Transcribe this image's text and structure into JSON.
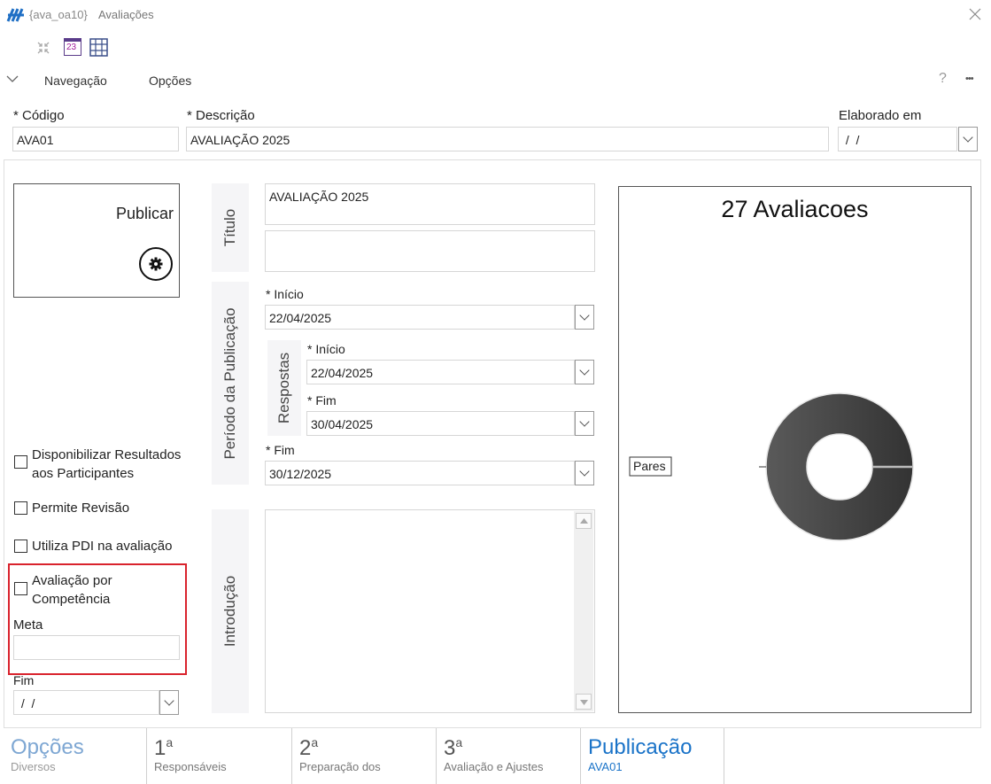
{
  "window": {
    "code": "{ava_oa10}",
    "title": "Avaliações"
  },
  "menu": {
    "nav_label": "Navegação",
    "options_label": "Opções",
    "help_symbol": "?",
    "more_symbol": "•••",
    "calendar_day": "23"
  },
  "header": {
    "codigo_label": "* Código",
    "codigo_value": "AVA01",
    "descricao_label": "* Descrição",
    "descricao_value": "AVALIAÇÃO 2025",
    "elaborado_label": "Elaborado em",
    "elaborado_value": " /  /"
  },
  "publish": {
    "label": "Publicar"
  },
  "titulo": {
    "label": "Título",
    "value": "AVALIAÇÃO 2025",
    "value2": ""
  },
  "periodo": {
    "label": "Período da Publicação",
    "inicio_label": "* Início",
    "inicio_value": "22/04/2025",
    "fim_label": "* Fim",
    "fim_value": "30/12/2025",
    "respostas": {
      "label": "Respostas",
      "inicio_label": "* Início",
      "inicio_value": "22/04/2025",
      "fim_label": "* Fim",
      "fim_value": "30/04/2025"
    }
  },
  "introducao": {
    "label": "Introdução"
  },
  "options": {
    "disponibilizar": "Disponibilizar Resultados aos Participantes",
    "permite_revisao": "Permite Revisão",
    "utiliza_pdi": "Utiliza PDI na avaliação",
    "competencia": "Avaliação por Competência",
    "meta_label": "Meta",
    "meta_value": "",
    "fim_label": "Fim",
    "fim_value": " /  /"
  },
  "chart_data": {
    "type": "pie",
    "title": "27 Avaliacoes",
    "labels": [
      "Pares"
    ],
    "values": [
      27
    ],
    "donut": true,
    "colors": [
      "#4a4a4a"
    ]
  },
  "tabs": [
    {
      "main": "Opções",
      "sub": "Diversos",
      "active": false,
      "faded": true
    },
    {
      "main": "1",
      "sup": "a",
      "sub": "Responsáveis"
    },
    {
      "main": "2",
      "sup": "a",
      "sub": "Preparação dos"
    },
    {
      "main": "3",
      "sup": "a",
      "sub": "Avaliação e Ajustes"
    },
    {
      "main": "Publicação",
      "sub": "AVA01",
      "active": true
    }
  ],
  "colors": {
    "accent": "#1a73c8",
    "highlight_border": "#d9232d",
    "faded_tab": "#7ea7d3"
  }
}
